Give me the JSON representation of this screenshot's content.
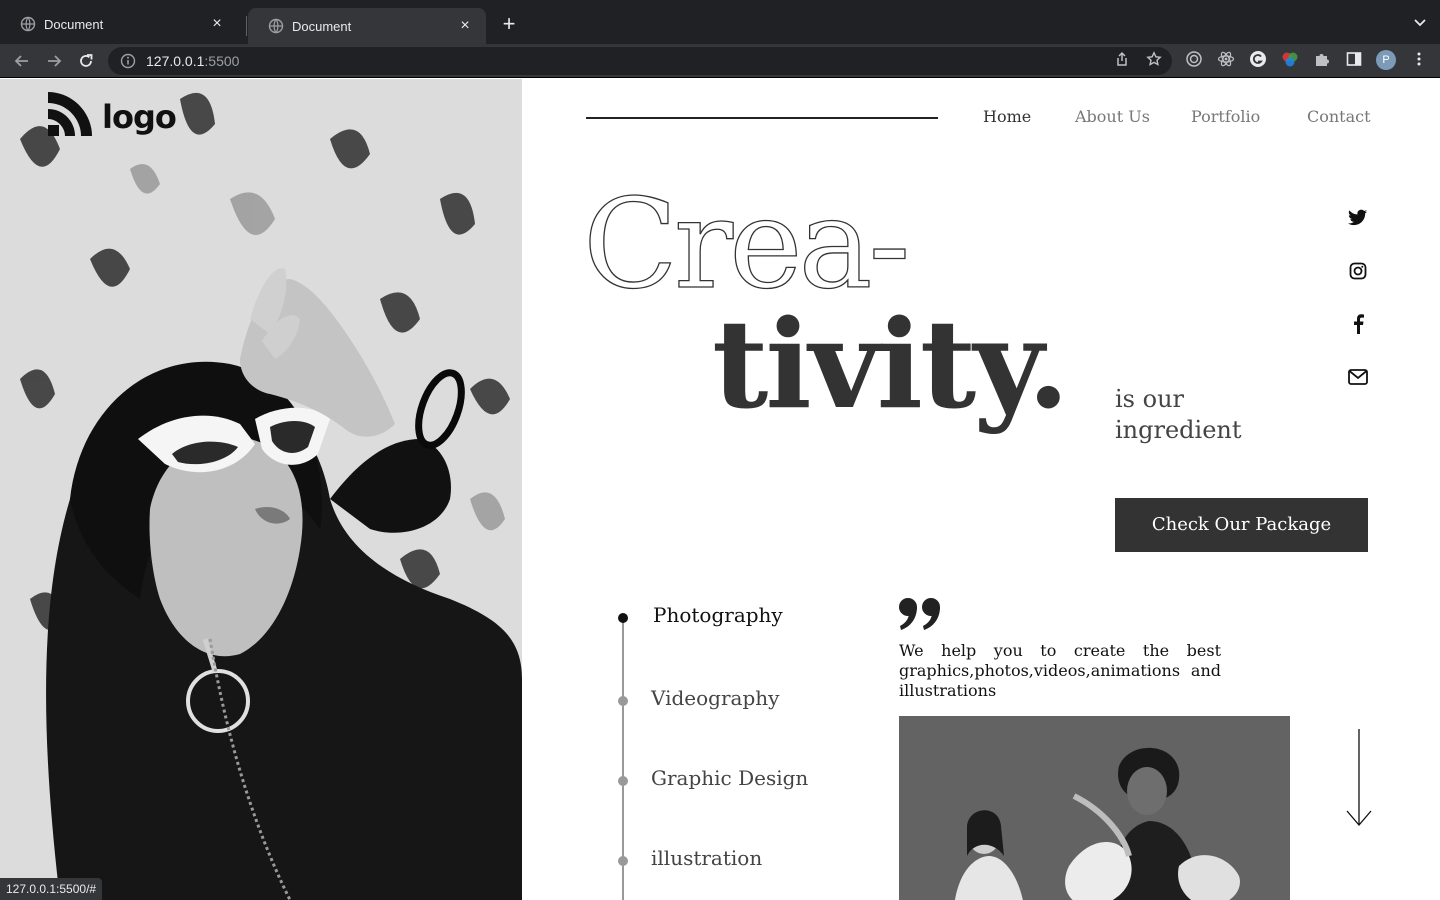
{
  "browser": {
    "tabs": [
      {
        "title": "Document",
        "close": "×"
      },
      {
        "title": "Document",
        "close": "×"
      }
    ],
    "new_tab": "+",
    "url_host": "127.0.0.1",
    "url_port": ":5500",
    "profile_initial": "P",
    "status_url": "127.0.0.1:5500/#"
  },
  "site": {
    "logo_text": "logo",
    "nav": [
      "Home",
      "About Us",
      "Portfolio",
      "Contact"
    ],
    "hero_line1": "Crea-",
    "hero_line2": "tivity.",
    "tagline": "is our ingredient",
    "cta_label": "Check Our Package",
    "services": [
      "Photography",
      "Videography",
      "Graphic Design",
      "illustration"
    ],
    "quote": "We help you to create the best graphics,photos,videos,animations and illustrations",
    "social": [
      "twitter-icon",
      "instagram-icon",
      "facebook-icon",
      "mail-icon"
    ]
  },
  "colors": {
    "accent": "#333333",
    "nav_inactive": "#777777",
    "timeline_inactive": "#999999"
  }
}
